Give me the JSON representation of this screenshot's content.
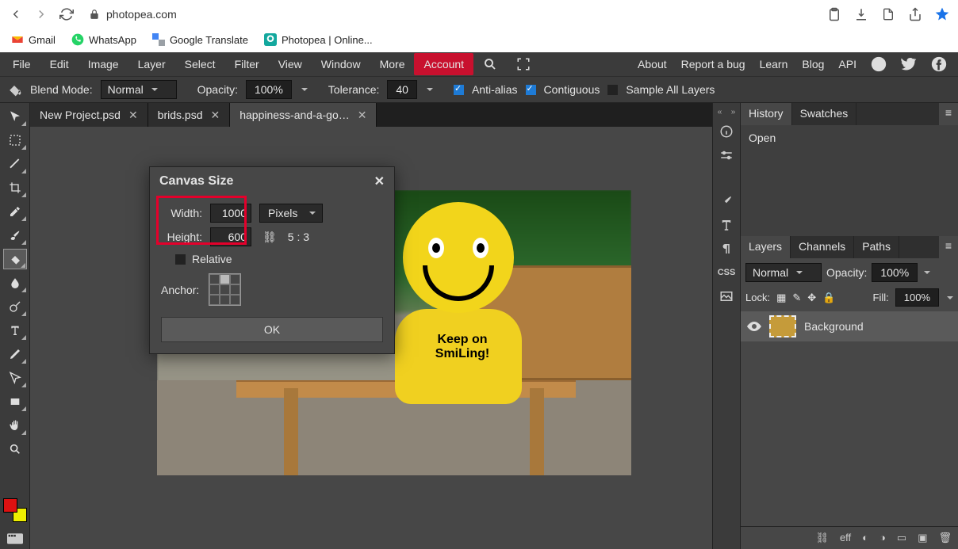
{
  "browser": {
    "url": "photopea.com",
    "bookmarks": [
      {
        "label": "Gmail",
        "color": "#d93025"
      },
      {
        "label": "WhatsApp",
        "color": "#25d366"
      },
      {
        "label": "Google Translate",
        "color": "#4285f4"
      },
      {
        "label": "Photopea | Online...",
        "color": "#15a89e"
      }
    ]
  },
  "menu": {
    "items": [
      "File",
      "Edit",
      "Image",
      "Layer",
      "Select",
      "Filter",
      "View",
      "Window",
      "More"
    ],
    "account": "Account",
    "right": [
      "About",
      "Report a bug",
      "Learn",
      "Blog",
      "API"
    ]
  },
  "options": {
    "blend_label": "Blend Mode:",
    "blend_value": "Normal",
    "opacity_label": "Opacity:",
    "opacity_value": "100%",
    "tolerance_label": "Tolerance:",
    "tolerance_value": "40",
    "antialias": "Anti-alias",
    "contiguous": "Contiguous",
    "sample_all": "Sample All Layers"
  },
  "tabs": [
    {
      "label": "New Project.psd",
      "active": false
    },
    {
      "label": "brids.psd",
      "active": false
    },
    {
      "label": "happiness-and-a-go…",
      "active": true
    }
  ],
  "dialog": {
    "title": "Canvas Size",
    "width_label": "Width:",
    "width_value": "1000",
    "height_label": "Height:",
    "height_value": "600",
    "units": "Pixels",
    "ratio": "5 : 3",
    "relative": "Relative",
    "anchor_label": "Anchor:",
    "ok": "OK"
  },
  "image_text": {
    "line1": "Keep on",
    "line2": "SmiLing!"
  },
  "history": {
    "tabs": [
      "History",
      "Swatches"
    ],
    "entries": [
      "Open"
    ]
  },
  "layers": {
    "tabs": [
      "Layers",
      "Channels",
      "Paths"
    ],
    "blend": "Normal",
    "opacity_label": "Opacity:",
    "opacity_value": "100%",
    "lock_label": "Lock:",
    "fill_label": "Fill:",
    "fill_value": "100%",
    "items": [
      {
        "name": "Background",
        "visible": true
      }
    ],
    "foot_eff": "eff"
  }
}
